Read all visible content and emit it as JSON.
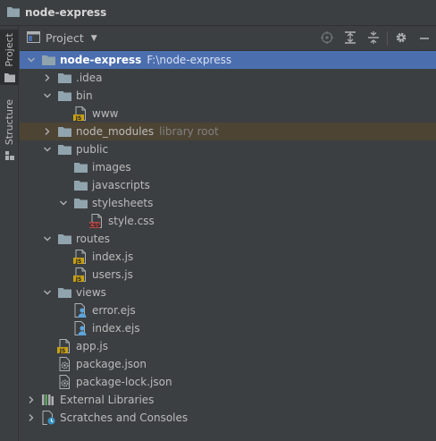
{
  "window": {
    "title": "node-express"
  },
  "side_tabs": [
    {
      "label": "Project"
    },
    {
      "label": "Structure"
    }
  ],
  "panel": {
    "title": "Project",
    "tools": [
      "locate-icon",
      "expand-all-icon",
      "collapse-all-icon",
      "gear-icon",
      "minimize-icon"
    ]
  },
  "tree": [
    {
      "name": "node-express",
      "hint": "F:\\node-express",
      "type": "folder",
      "depth": 0,
      "expanded": true,
      "selected": true
    },
    {
      "name": ".idea",
      "type": "folder",
      "depth": 1,
      "expanded": false
    },
    {
      "name": "bin",
      "type": "folder",
      "depth": 1,
      "expanded": true
    },
    {
      "name": "www",
      "type": "js",
      "depth": 2
    },
    {
      "name": "node_modules",
      "hint": "library root",
      "type": "folder",
      "depth": 1,
      "expanded": false,
      "excluded": true
    },
    {
      "name": "public",
      "type": "folder",
      "depth": 1,
      "expanded": true
    },
    {
      "name": "images",
      "type": "folder",
      "depth": 2,
      "leaf": true
    },
    {
      "name": "javascripts",
      "type": "folder",
      "depth": 2,
      "leaf": true
    },
    {
      "name": "stylesheets",
      "type": "folder",
      "depth": 2,
      "expanded": true
    },
    {
      "name": "style.css",
      "type": "css",
      "depth": 3
    },
    {
      "name": "routes",
      "type": "folder",
      "depth": 1,
      "expanded": true
    },
    {
      "name": "index.js",
      "type": "js",
      "depth": 2
    },
    {
      "name": "users.js",
      "type": "js",
      "depth": 2
    },
    {
      "name": "views",
      "type": "folder",
      "depth": 1,
      "expanded": true
    },
    {
      "name": "error.ejs",
      "type": "ejs",
      "depth": 2
    },
    {
      "name": "index.ejs",
      "type": "ejs",
      "depth": 2
    },
    {
      "name": "app.js",
      "type": "js",
      "depth": 1
    },
    {
      "name": "package.json",
      "type": "json",
      "depth": 1
    },
    {
      "name": "package-lock.json",
      "type": "json",
      "depth": 1
    },
    {
      "name": "External Libraries",
      "type": "libraries",
      "depth": 0,
      "expanded": false
    },
    {
      "name": "Scratches and Consoles",
      "type": "scratches",
      "depth": 0,
      "expanded": false
    }
  ],
  "icon_badges": {
    "js": "JS",
    "css": "CSS"
  },
  "colors": {
    "background": "#3c3f41",
    "selection": "#4b6eaf",
    "excluded_row": "#4d4434",
    "folder": "#90a4ae",
    "js_badge": "#c7a017",
    "css_badge": "#b34b4b",
    "text": "#bbbbbb"
  }
}
